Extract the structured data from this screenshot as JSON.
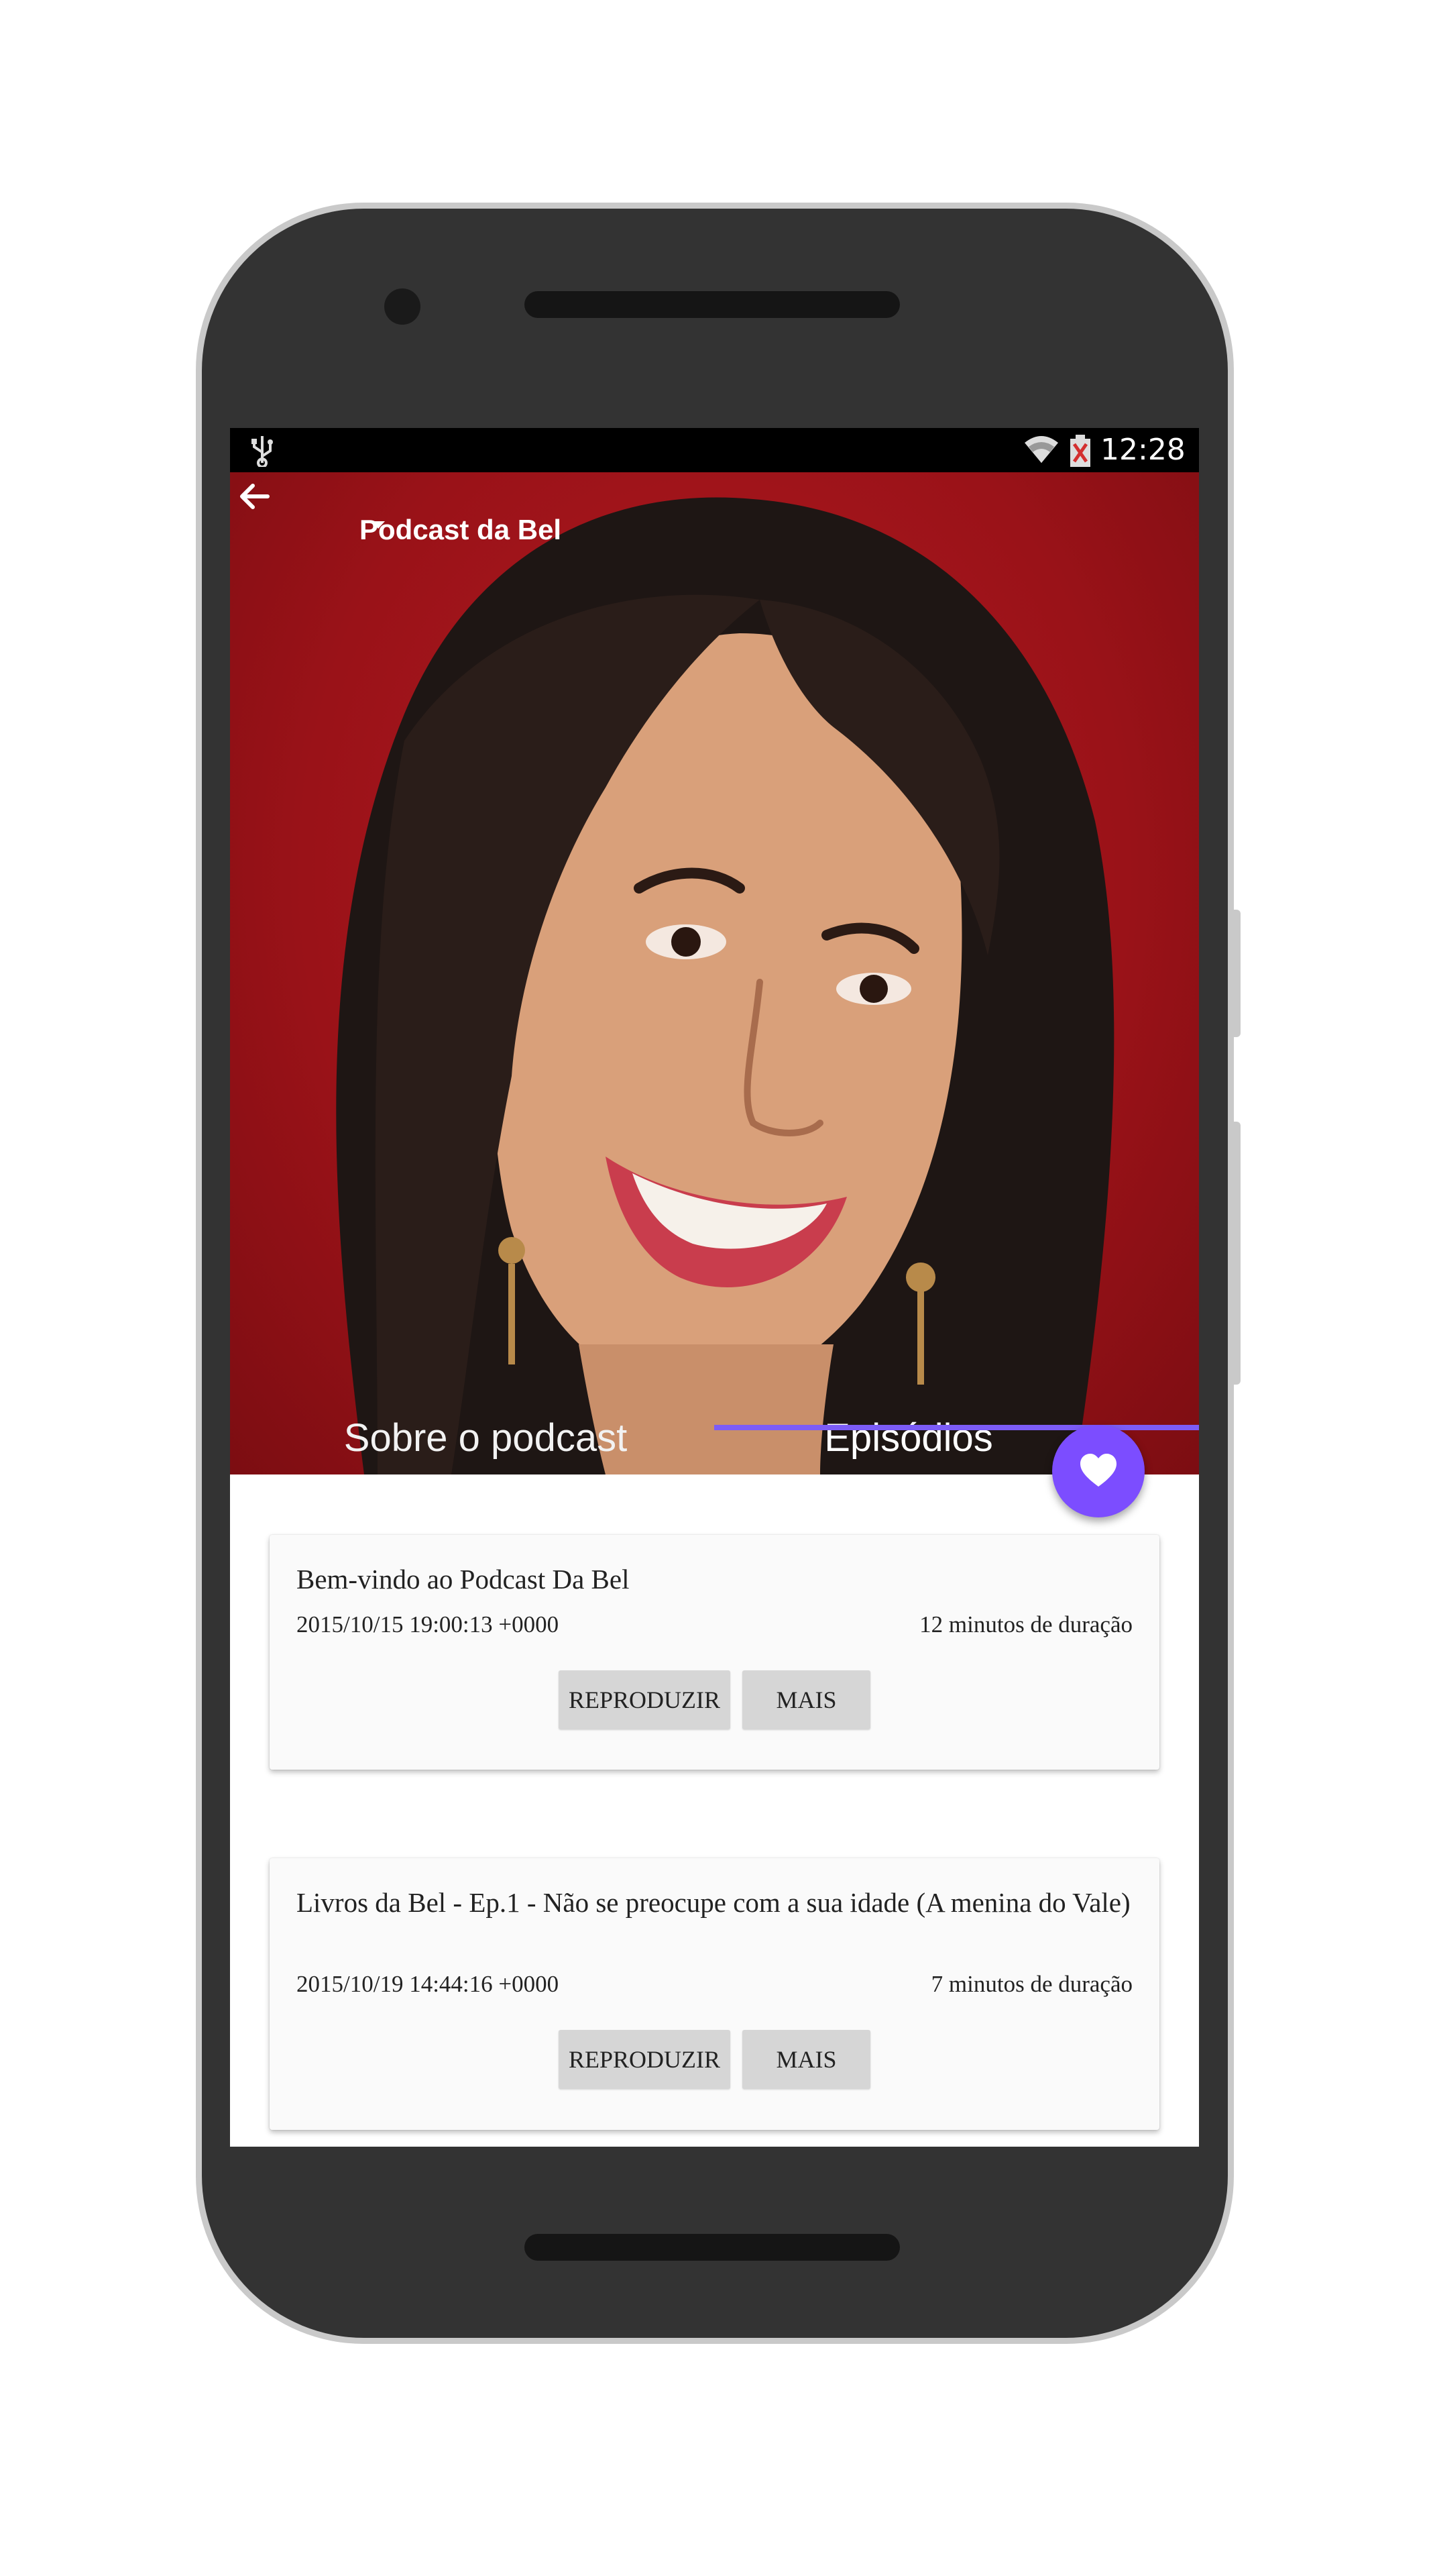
{
  "status_bar": {
    "time": "12:28",
    "usb_icon": "usb-icon",
    "wifi_icon": "wifi-icon",
    "battery_icon": "battery-icon"
  },
  "toolbar": {
    "title": "Podcast da Bel",
    "back_icon": "arrow-back-icon",
    "dropdown_icon": "caret-down-icon"
  },
  "tabs": [
    {
      "label": "Sobre o podcast",
      "selected": false
    },
    {
      "label": "Episódios",
      "selected": true
    }
  ],
  "fab": {
    "icon": "heart-icon",
    "color": "#7c4dff"
  },
  "episodes": [
    {
      "title": "Bem-vindo ao Podcast Da Bel",
      "date": "2015/10/15 19:00:13 +0000",
      "duration": "12 minutos de duração",
      "play_label": "REPRODUZIR",
      "more_label": "MAIS"
    },
    {
      "title": "Livros da Bel - Ep.1 - Não se preocupe com a sua idade (A menina do Vale)",
      "date": "2015/10/19 14:44:16 +0000",
      "duration": "7 minutos de duração",
      "play_label": "REPRODUZIR",
      "more_label": "MAIS"
    }
  ],
  "colors": {
    "accent": "#7c4dff",
    "hero_background": "#9a1218",
    "status_bar": "#000000"
  }
}
